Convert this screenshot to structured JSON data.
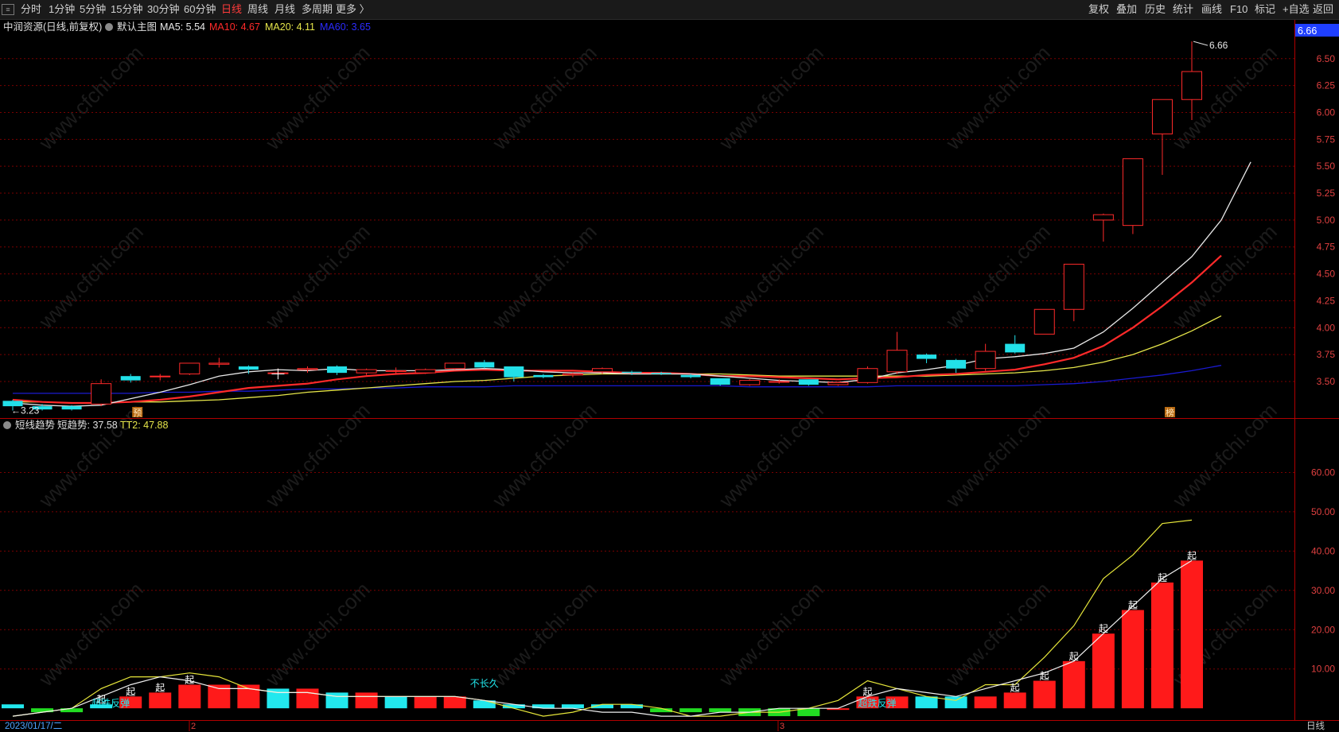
{
  "toolbar": {
    "left_items": [
      "分时",
      "1分钟",
      "5分钟",
      "15分钟",
      "30分钟",
      "60分钟",
      "日线",
      "周线",
      "月线",
      "多周期",
      "更多 〉"
    ],
    "active": "日线",
    "right_items": [
      "复权",
      "叠加",
      "历史",
      "统计",
      "画线",
      "F10",
      "标记",
      "+自选",
      "返回"
    ]
  },
  "main_info": {
    "title": "中润资源(日线,前复权)",
    "template": "默认主图",
    "ma5": "MA5: 5.54",
    "ma10": "MA10: 4.67",
    "ma20": "MA20: 4.11",
    "ma60": "MA60: 3.65",
    "colors": {
      "ma5": "#e8e8e8",
      "ma10": "#ff2a2a",
      "ma20": "#e6e64a",
      "ma60": "#1a1ad0"
    }
  },
  "main_axis": {
    "ticks": [
      "6.50",
      "6.25",
      "6.00",
      "5.75",
      "5.50",
      "5.25",
      "5.00",
      "4.75",
      "4.50",
      "4.25",
      "4.00",
      "3.75",
      "3.50"
    ],
    "top_tag": "6.66",
    "high_label": "6.66",
    "low_label": "3.23",
    "ymin": 3.16,
    "ymax": 6.72
  },
  "sub_info": {
    "name": "短线趋势",
    "value": "短趋势: 37.58",
    "tt2": "TT2: 47.88"
  },
  "sub_axis": {
    "ticks": [
      "60.00",
      "50.00",
      "40.00",
      "30.00",
      "20.00",
      "10.00"
    ],
    "ymin": -3,
    "ymax": 70
  },
  "markers": {
    "yu": "预",
    "bang": "榜",
    "qi": "起",
    "fantan": "超跌反弹",
    "buchangjiu": "不长久"
  },
  "month_marks": [
    "2",
    "3"
  ],
  "bottom": {
    "date": "2023/01/17/二",
    "period": "日线"
  },
  "watermark": "www.cfchi.com",
  "chart_data": {
    "type": "candlestick",
    "candles": [
      {
        "o": 3.32,
        "c": 3.27,
        "h": 3.33,
        "l": 3.23
      },
      {
        "o": 3.27,
        "c": 3.24,
        "h": 3.29,
        "l": 3.23
      },
      {
        "o": 3.27,
        "c": 3.24,
        "h": 3.28,
        "l": 3.23
      },
      {
        "o": 3.29,
        "c": 3.48,
        "h": 3.52,
        "l": 3.27
      },
      {
        "o": 3.55,
        "c": 3.51,
        "h": 3.57,
        "l": 3.49
      },
      {
        "o": 3.55,
        "c": 3.55,
        "h": 3.57,
        "l": 3.51
      },
      {
        "o": 3.57,
        "c": 3.67,
        "h": 3.67,
        "l": 3.56
      },
      {
        "o": 3.66,
        "c": 3.67,
        "h": 3.72,
        "l": 3.63
      },
      {
        "o": 3.64,
        "c": 3.61,
        "h": 3.65,
        "l": 3.57
      },
      {
        "o": 3.58,
        "c": 3.58,
        "h": 3.62,
        "l": 3.56
      },
      {
        "o": 3.61,
        "c": 3.62,
        "h": 3.64,
        "l": 3.58
      },
      {
        "o": 3.64,
        "c": 3.58,
        "h": 3.65,
        "l": 3.56
      },
      {
        "o": 3.58,
        "c": 3.61,
        "h": 3.62,
        "l": 3.56
      },
      {
        "o": 3.6,
        "c": 3.6,
        "h": 3.63,
        "l": 3.57
      },
      {
        "o": 3.58,
        "c": 3.61,
        "h": 3.62,
        "l": 3.57
      },
      {
        "o": 3.62,
        "c": 3.67,
        "h": 3.67,
        "l": 3.61
      },
      {
        "o": 3.68,
        "c": 3.63,
        "h": 3.7,
        "l": 3.62
      },
      {
        "o": 3.64,
        "c": 3.54,
        "h": 3.64,
        "l": 3.5
      },
      {
        "o": 3.56,
        "c": 3.54,
        "h": 3.57,
        "l": 3.53
      },
      {
        "o": 3.56,
        "c": 3.57,
        "h": 3.58,
        "l": 3.54
      },
      {
        "o": 3.59,
        "c": 3.62,
        "h": 3.63,
        "l": 3.57
      },
      {
        "o": 3.59,
        "c": 3.58,
        "h": 3.6,
        "l": 3.56
      },
      {
        "o": 3.58,
        "c": 3.57,
        "h": 3.59,
        "l": 3.56
      },
      {
        "o": 3.56,
        "c": 3.54,
        "h": 3.57,
        "l": 3.53
      },
      {
        "o": 3.53,
        "c": 3.47,
        "h": 3.53,
        "l": 3.46
      },
      {
        "o": 3.47,
        "c": 3.51,
        "h": 3.52,
        "l": 3.46
      },
      {
        "o": 3.5,
        "c": 3.5,
        "h": 3.52,
        "l": 3.48
      },
      {
        "o": 3.52,
        "c": 3.47,
        "h": 3.52,
        "l": 3.46
      },
      {
        "o": 3.47,
        "c": 3.49,
        "h": 3.5,
        "l": 3.46
      },
      {
        "o": 3.49,
        "c": 3.62,
        "h": 3.64,
        "l": 3.48
      },
      {
        "o": 3.59,
        "c": 3.79,
        "h": 3.96,
        "l": 3.57
      },
      {
        "o": 3.75,
        "c": 3.71,
        "h": 3.76,
        "l": 3.67
      },
      {
        "o": 3.7,
        "c": 3.62,
        "h": 3.71,
        "l": 3.58
      },
      {
        "o": 3.62,
        "c": 3.78,
        "h": 3.85,
        "l": 3.6
      },
      {
        "o": 3.85,
        "c": 3.77,
        "h": 3.93,
        "l": 3.76
      },
      {
        "o": 3.94,
        "c": 4.17,
        "h": 4.17,
        "l": 3.94
      },
      {
        "o": 4.17,
        "c": 4.59,
        "h": 4.59,
        "l": 4.06
      },
      {
        "o": 5.0,
        "c": 5.05,
        "h": 5.06,
        "l": 4.8
      },
      {
        "o": 4.95,
        "c": 5.57,
        "h": 5.57,
        "l": 4.87
      },
      {
        "o": 5.8,
        "c": 6.12,
        "h": 6.12,
        "l": 5.42
      },
      {
        "o": 6.12,
        "c": 6.38,
        "h": 6.66,
        "l": 5.93
      }
    ],
    "ma5": [
      3.3,
      3.28,
      3.27,
      3.28,
      3.34,
      3.4,
      3.47,
      3.55,
      3.59,
      3.61,
      3.6,
      3.62,
      3.6,
      3.6,
      3.6,
      3.61,
      3.62,
      3.61,
      3.59,
      3.58,
      3.58,
      3.57,
      3.57,
      3.57,
      3.55,
      3.53,
      3.51,
      3.5,
      3.49,
      3.52,
      3.58,
      3.61,
      3.65,
      3.71,
      3.73,
      3.76,
      3.81,
      3.96,
      4.18,
      4.42,
      4.66,
      5.0,
      5.54
    ],
    "ma10": [
      3.33,
      3.31,
      3.3,
      3.3,
      3.31,
      3.33,
      3.36,
      3.4,
      3.44,
      3.46,
      3.48,
      3.52,
      3.55,
      3.57,
      3.58,
      3.6,
      3.61,
      3.6,
      3.6,
      3.6,
      3.59,
      3.58,
      3.58,
      3.57,
      3.55,
      3.55,
      3.54,
      3.53,
      3.52,
      3.53,
      3.54,
      3.56,
      3.57,
      3.59,
      3.61,
      3.66,
      3.72,
      3.83,
      4.0,
      4.2,
      4.42,
      4.67
    ],
    "ma20": [
      3.31,
      3.31,
      3.3,
      3.3,
      3.31,
      3.31,
      3.32,
      3.33,
      3.35,
      3.37,
      3.4,
      3.42,
      3.44,
      3.46,
      3.48,
      3.5,
      3.51,
      3.53,
      3.55,
      3.56,
      3.57,
      3.57,
      3.57,
      3.57,
      3.57,
      3.56,
      3.55,
      3.55,
      3.55,
      3.55,
      3.55,
      3.55,
      3.56,
      3.57,
      3.58,
      3.6,
      3.63,
      3.68,
      3.75,
      3.85,
      3.97,
      4.11
    ],
    "ma60": [
      3.39,
      3.39,
      3.39,
      3.39,
      3.39,
      3.4,
      3.4,
      3.41,
      3.41,
      3.42,
      3.43,
      3.43,
      3.44,
      3.44,
      3.45,
      3.45,
      3.45,
      3.46,
      3.46,
      3.46,
      3.46,
      3.46,
      3.46,
      3.46,
      3.46,
      3.45,
      3.45,
      3.45,
      3.45,
      3.45,
      3.46,
      3.46,
      3.46,
      3.46,
      3.46,
      3.47,
      3.48,
      3.5,
      3.53,
      3.56,
      3.6,
      3.65
    ],
    "sub_bars": [
      1,
      -1,
      -1,
      1,
      3,
      4,
      6,
      6,
      6,
      5,
      5,
      4,
      4,
      3,
      3,
      3,
      2,
      1,
      1,
      1,
      1,
      1,
      -1,
      -1,
      -1,
      -2,
      -2,
      -2,
      0,
      3,
      3,
      3,
      3,
      3,
      4,
      7,
      12,
      19,
      25,
      32,
      37.58
    ],
    "sub_trend": [
      -2,
      -1,
      0,
      3,
      6,
      8,
      7,
      5,
      5,
      4,
      4,
      3,
      3,
      3,
      3,
      3,
      2,
      1,
      0,
      0,
      -1,
      -1,
      -2,
      -2,
      -1,
      -1,
      0,
      0,
      0,
      3,
      5,
      4,
      3,
      5,
      7,
      9,
      12,
      19,
      26,
      33,
      37.58
    ],
    "tt2": [
      -2,
      -1,
      0,
      5,
      8,
      8,
      9,
      8,
      5,
      4,
      4,
      3,
      3,
      3,
      3,
      3,
      2,
      0,
      -2,
      -1,
      1,
      1,
      0,
      -2,
      -2,
      -1,
      -1,
      0,
      2,
      7,
      5,
      3,
      2,
      6,
      6,
      13,
      21,
      33,
      39,
      47,
      47.88
    ]
  }
}
